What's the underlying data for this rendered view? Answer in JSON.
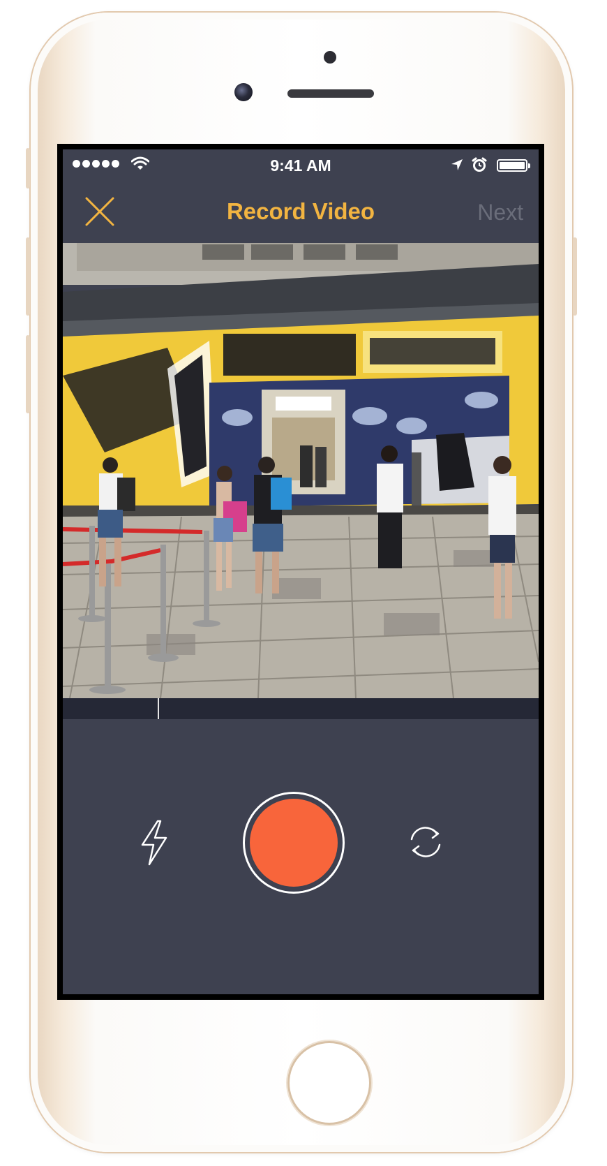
{
  "statusbar": {
    "time": "9:41 AM",
    "signal_bars": 5,
    "icons": [
      "wifi-icon",
      "location-arrow-icon",
      "alarm-icon",
      "battery-icon"
    ]
  },
  "navbar": {
    "close_icon": "close-icon",
    "title": "Record Video",
    "next_label": "Next"
  },
  "viewfinder": {
    "description_icon": "camera-preview"
  },
  "timeline": {
    "progress": 0.2
  },
  "controls": {
    "flash_icon": "flash-icon",
    "record_icon": "record-button",
    "flip_icon": "flip-camera-icon"
  },
  "colors": {
    "accent": "#f2b441",
    "record": "#f8653b",
    "background": "#3e4150",
    "timeline": "#252836",
    "next_disabled": "#6a6d7a"
  }
}
